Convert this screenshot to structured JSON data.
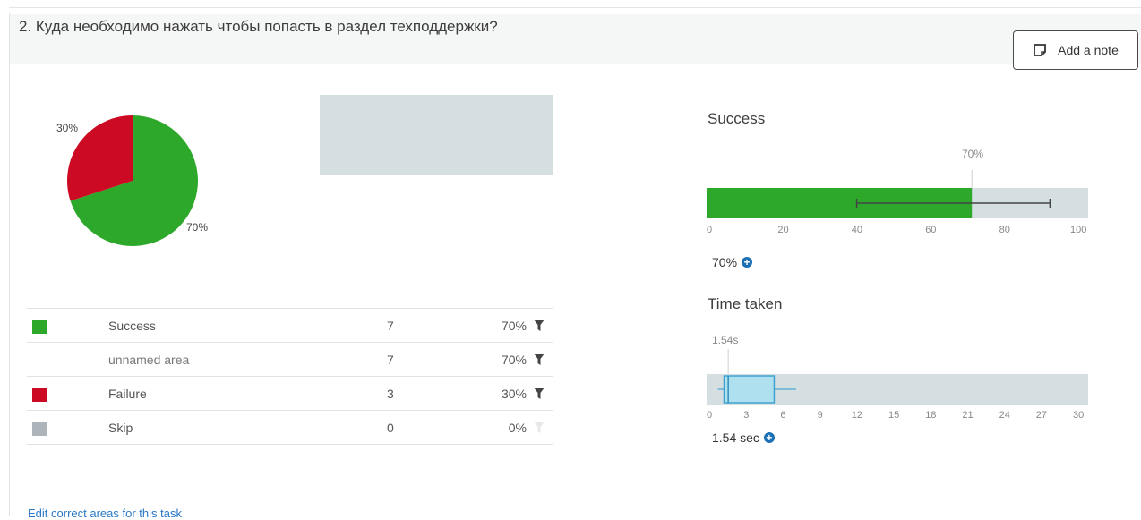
{
  "question": {
    "title": "2. Куда необходимо нажать чтобы попасть в раздел техподдержки?"
  },
  "note_button": {
    "label": "Add a note",
    "icon": "note-icon"
  },
  "pie": {
    "slices": [
      {
        "label": "70%",
        "value": 70,
        "color": "#2ea82a"
      },
      {
        "label": "30%",
        "value": 30,
        "color": "#cc0a24"
      }
    ]
  },
  "results_table": {
    "rows": [
      {
        "name": "Success",
        "count": "7",
        "percent": "70%",
        "color": "#2ea82a",
        "filter_active": true
      },
      {
        "name": "unnamed area",
        "count": "7",
        "percent": "70%",
        "color": "",
        "filter_active": true
      },
      {
        "name": "Failure",
        "count": "3",
        "percent": "30%",
        "color": "#cc0a24",
        "filter_active": true
      },
      {
        "name": "Skip",
        "count": "0",
        "percent": "0%",
        "color": "#adb5ba",
        "filter_active": false
      }
    ]
  },
  "success_panel": {
    "title": "Success",
    "bar_label": "70%",
    "value": 70,
    "error_low": 37,
    "error_high": 90,
    "ticks": [
      "0",
      "20",
      "40",
      "60",
      "80",
      "100"
    ],
    "summary": "70%"
  },
  "time_panel": {
    "title": "Time taken",
    "median_label": "1.54s",
    "median": 1.54,
    "q1": 1.2,
    "q3": 4.4,
    "whisker_low": 0.7,
    "whisker_high": 5.6,
    "ticks": [
      "0",
      "3",
      "6",
      "9",
      "12",
      "15",
      "18",
      "21",
      "24",
      "27",
      "30"
    ],
    "summary": "1.54 sec"
  },
  "edit_link": {
    "label": "Edit correct areas for this task"
  },
  "colors": {
    "success": "#2ea82a",
    "failure": "#cc0a24",
    "skip": "#adb5ba",
    "track": "#d5dee1",
    "box": "#aee0ef",
    "link": "#2a78c4"
  }
}
